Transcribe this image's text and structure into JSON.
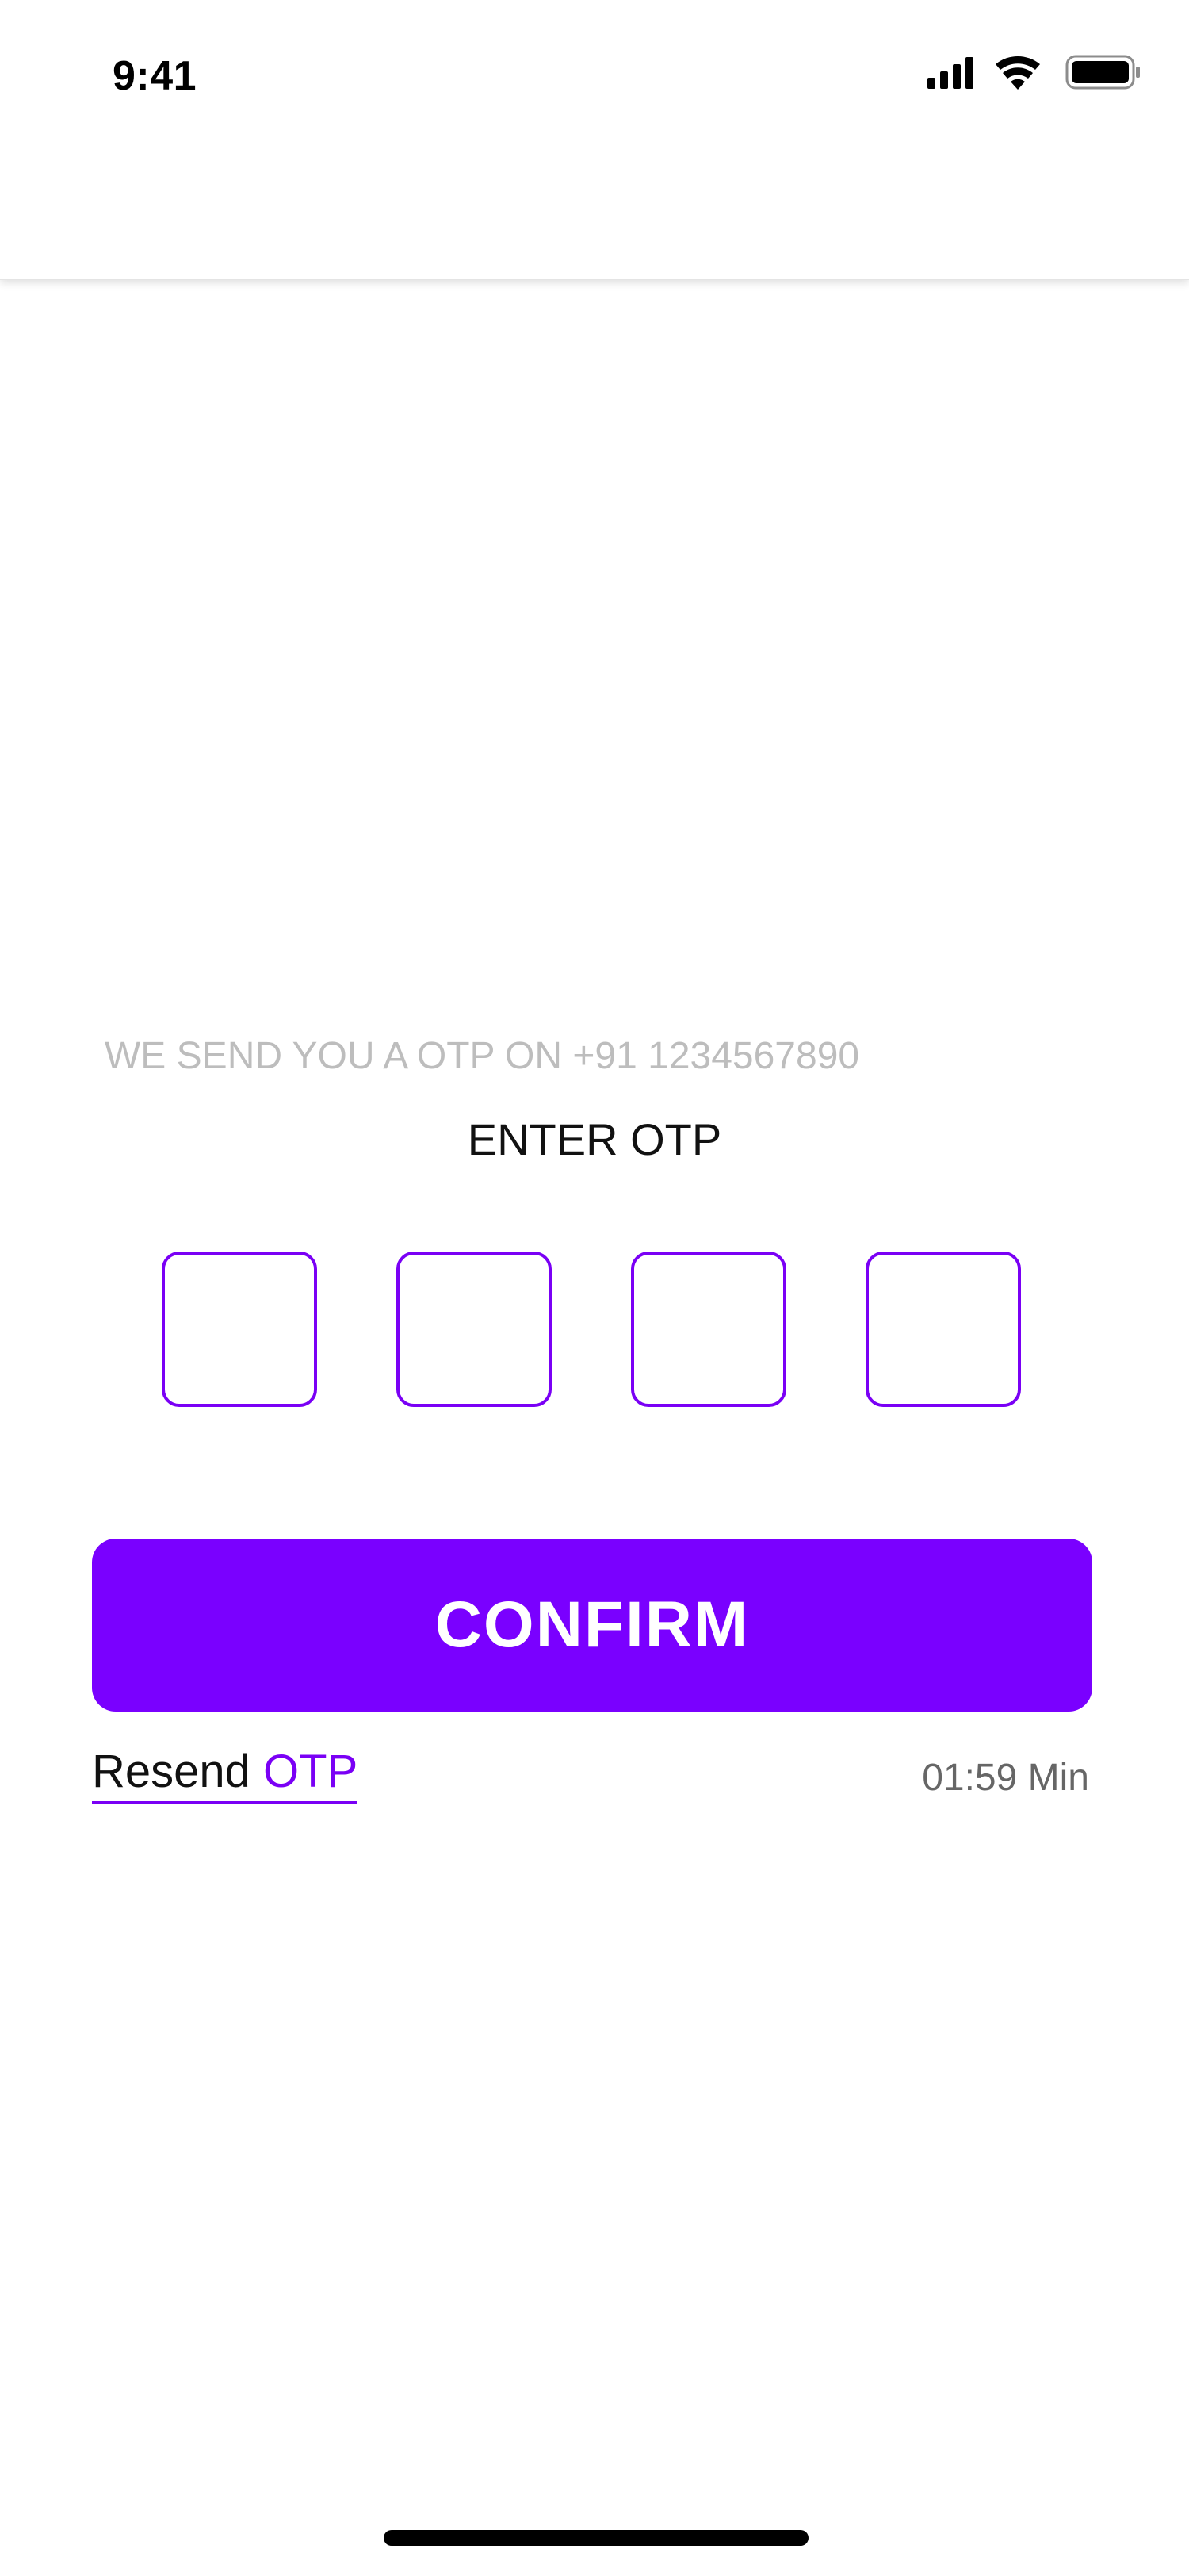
{
  "status_bar": {
    "time": "9:41",
    "icons": [
      "cellular-signal-icon",
      "wifi-icon",
      "battery-icon"
    ]
  },
  "otp_screen": {
    "info_text": "WE SEND YOU A OTP ON +91 1234567890",
    "title": "ENTER OTP",
    "digit_values": [
      "",
      "",
      "",
      ""
    ],
    "confirm_label": "CONFIRM",
    "resend_prefix": "Resend",
    "resend_accent": "OTP",
    "timer": "01:59 Min"
  },
  "colors": {
    "accent": "#7A00FF",
    "muted_text": "#BDBDBD",
    "timer_text": "#666666"
  }
}
